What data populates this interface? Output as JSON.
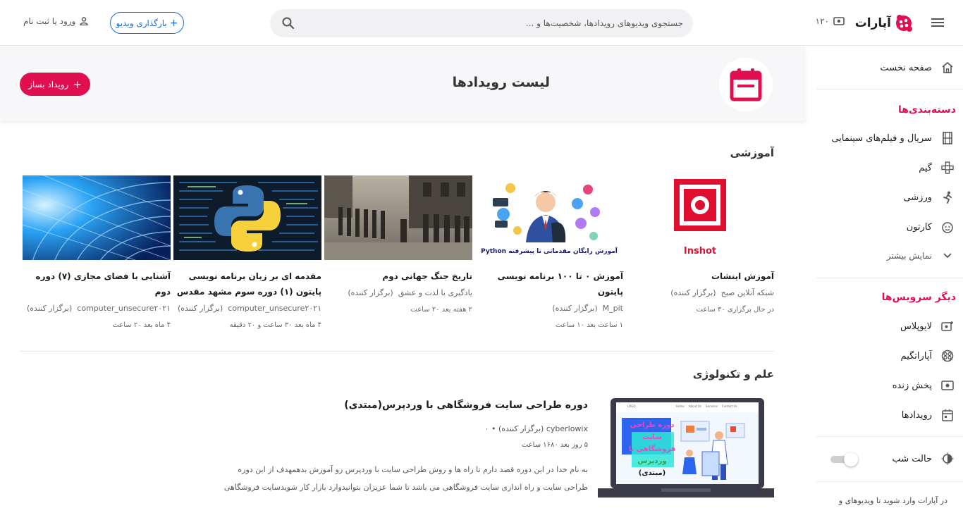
{
  "colors": {
    "brand": "#df0f50",
    "link": "#1d6ad3"
  },
  "header": {
    "logo_text": "آپارات",
    "live_count": "۱۲۰",
    "search_placeholder": "جستجوی ویدیوهای رویدادها، شخصیت‌ها و ...",
    "upload_label": "بارگذاری ویدیو",
    "login_label": "ورود یا ثبت نام"
  },
  "sidebar": {
    "home": "صفحه نخست",
    "categories_heading": "دسته‌بندی‌ها",
    "categories": [
      {
        "label": "سریال و فیلم‌های سینمایی",
        "icon": "film-icon"
      },
      {
        "label": "گیم",
        "icon": "gamepad-icon"
      },
      {
        "label": "ورزشی",
        "icon": "running-icon"
      },
      {
        "label": "کارتون",
        "icon": "cartoon-face-icon"
      }
    ],
    "show_more": "نمایش بیشتر",
    "services_heading": "دیگر سرویس‌ها",
    "services": [
      {
        "label": "لایوپلاس",
        "icon": "liveplus-icon"
      },
      {
        "label": "آپاراتگیم",
        "icon": "aparatgame-icon"
      },
      {
        "label": "پخش زنده",
        "icon": "live-icon"
      },
      {
        "label": "رویدادها",
        "icon": "calendar-icon"
      }
    ],
    "night_mode": "حالت شب",
    "footer_text": "در آپارات وارد شوید تا ویدیوهای و"
  },
  "banner": {
    "title": "لیست رویدادها",
    "create_button": "رویداد بساز"
  },
  "sections": [
    {
      "title": "آموزشی",
      "cards": [
        {
          "title": "آموزش اینشات",
          "organizer": "شبکه آنلاین صبح",
          "organizer_tag": "(برگزار کننده)",
          "time": "در حال برگزاری ۳۰ ساعت",
          "thumb_text": "Inshot"
        },
        {
          "title": "آموزش ۰ تا ۱۰۰ برنامه نویسی پایتون",
          "organizer": "M_pit",
          "organizer_tag": "(برگزار کننده)",
          "time": "۱ ساعت بعد ۱۰ ساعت",
          "thumb_text": "آموزش رایگان مقدماتی تا پیشرفته Python"
        },
        {
          "title": "تاریخ جنگ جهانی دوم",
          "organizer": "یادگیری با لذت و عشق",
          "organizer_tag": "(برگزار کننده)",
          "time": "۲ هفته بعد ۲۰ ساعت",
          "thumb_text": ""
        },
        {
          "title": "مقدمه ای بر زبان برنامه نویسی پایتون (۱) دوره سوم مشهد مقدس",
          "organizer": "computer_unsecure۲۰۲۱",
          "organizer_tag": "(برگزار کننده)",
          "time": "۴ ماه بعد ۳۰ ساعت و ۲۰ دقیقه",
          "thumb_text": ""
        },
        {
          "title": "آشنایی با فضای مجازی (۷) دوره دوم",
          "organizer": "computer_unsecure۲۰۲۱",
          "organizer_tag": "(برگزار کننده)",
          "time": "۴ ماه بعد ۲۰ ساعت",
          "thumb_text": ""
        }
      ]
    },
    {
      "title": "علم و تکنولوژی",
      "featured": {
        "title": "دوره طراحی سایت فروشگاهی با وردپرس(مبتدی)",
        "organizer": "cyberlowix",
        "organizer_tag": "(برگزار کننده)",
        "count": "۰",
        "time": "۵ روز بعد ۱۶۸۰ ساعت",
        "description": "به نام خدا در این دوره قصد دارم تا راه ها و روش طراحی سایت با وردپرس رو آموزش بدهمهدف از این دوره طراحی سایت و راه اندازی سایت فروشگاهی می باشد تا شما عزیزان بتوانیدوارد بازار کار شویدسایت فروشگاهی",
        "thumb_lines": [
          "دوره طراحی سایت",
          "فروشگاهی با",
          "وردپرس",
          "(مبتدی)"
        ],
        "thumb_logo": "LOGO",
        "thumb_nav": [
          "Home",
          "About Us",
          "Services",
          "Contact Us"
        ]
      }
    }
  ]
}
